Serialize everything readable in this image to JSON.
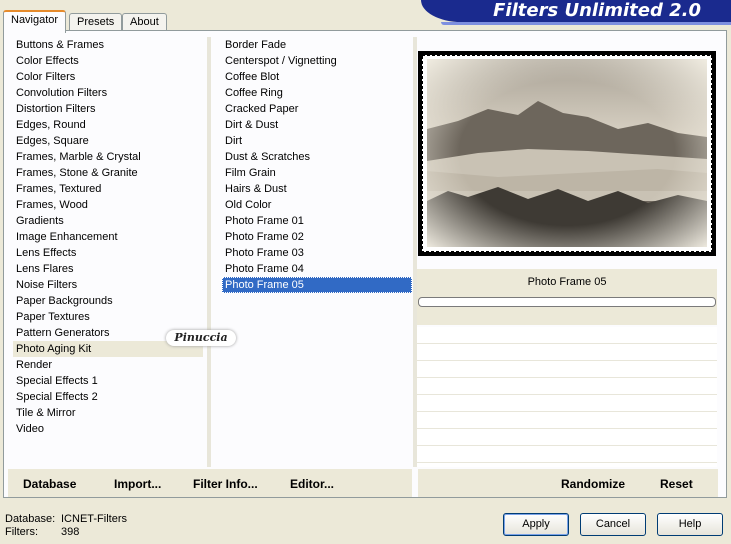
{
  "brand": "Filters Unlimited 2.0",
  "tabs": [
    {
      "label": "Navigator",
      "active": true
    },
    {
      "label": "Presets",
      "active": false
    },
    {
      "label": "About",
      "active": false
    }
  ],
  "categories": {
    "items": [
      "Buttons & Frames",
      "Color Effects",
      "Color Filters",
      "Convolution Filters",
      "Distortion Filters",
      "Edges, Round",
      "Edges, Square",
      "Frames, Marble & Crystal",
      "Frames, Stone & Granite",
      "Frames, Textured",
      "Frames, Wood",
      "Gradients",
      "Image Enhancement",
      "Lens Effects",
      "Lens Flares",
      "Noise Filters",
      "Paper Backgrounds",
      "Paper Textures",
      "Pattern Generators",
      "Photo Aging Kit",
      "Render",
      "Special Effects 1",
      "Special Effects 2",
      "Tile & Mirror",
      "Video"
    ],
    "selected": "Photo Aging Kit"
  },
  "filters": {
    "items": [
      "Border Fade",
      "Centerspot / Vignetting",
      "Coffee Blot",
      "Coffee Ring",
      "Cracked Paper",
      "Dirt & Dust",
      "Dirt",
      "Dust & Scratches",
      "Film Grain",
      "Hairs & Dust",
      "Old Color",
      "Photo Frame 01",
      "Photo Frame 02",
      "Photo Frame 03",
      "Photo Frame 04",
      "Photo Frame 05"
    ],
    "selected": "Photo Frame 05"
  },
  "preview": {
    "filter_name": "Photo Frame 05",
    "slider_value": 0
  },
  "toolbar": {
    "database": "Database",
    "import": "Import...",
    "filter_info": "Filter Info...",
    "editor": "Editor...",
    "randomize": "Randomize",
    "reset": "Reset"
  },
  "status": {
    "database_label": "Database:",
    "database_value": "ICNET-Filters",
    "filters_label": "Filters:",
    "filters_value": "398"
  },
  "buttons": {
    "apply": "Apply",
    "cancel": "Cancel",
    "help": "Help"
  },
  "watermark": "Pinuccia",
  "colors": {
    "selection": "#316ac5",
    "brand_bg": "#1a2a8e",
    "dialog_bg": "#ece9d8",
    "tab_accent": "#e68b2c"
  }
}
